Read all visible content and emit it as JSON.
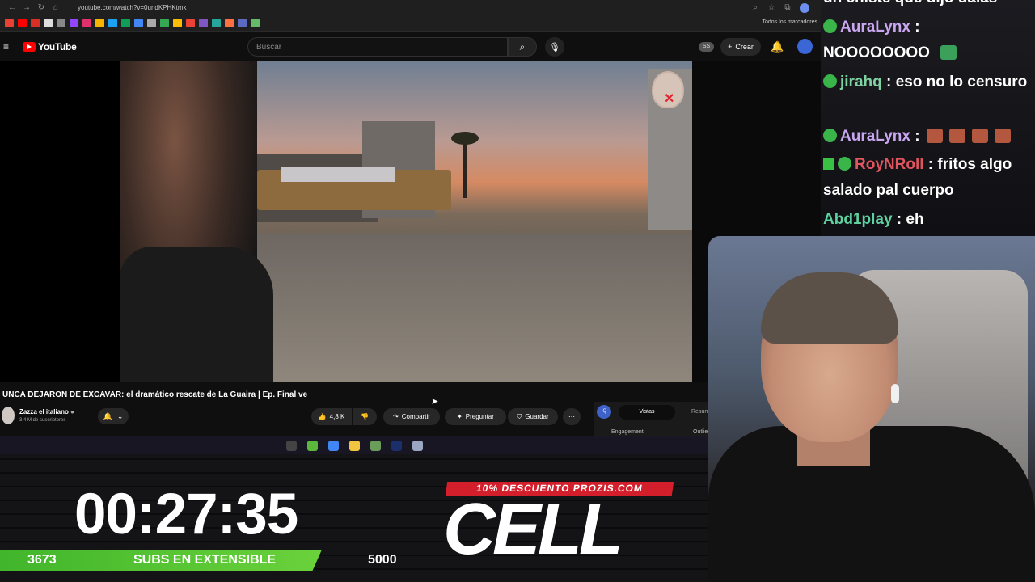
{
  "browser": {
    "url": "youtube.com/watch?v=0undKPHKtmk",
    "bookmarks_folder": "Todos los marcadores"
  },
  "youtube": {
    "logo_text": "YouTube",
    "search_placeholder": "Buscar",
    "badge": "SS",
    "create_label": "Crear"
  },
  "video": {
    "title": "UNCA DEJARON DE EXCAVAR: el dramático rescate de La Guaira | Ep. Final ve",
    "channel": "Zazza el italiano",
    "subscribers": "3,4 M de suscriptores",
    "likes": "4,8 K",
    "share_label": "Compartir",
    "ask_label": "Preguntar",
    "save_label": "Guardar"
  },
  "stats": {
    "badge": "IQ",
    "tab_active": "Vistas",
    "tab_next": "Resum",
    "label_1": "Engagement",
    "label_2": "Outlie"
  },
  "overlay": {
    "timer": "00:27:35",
    "subs_count": "3673",
    "subs_label": "SUBS EN EXTENSIBLE",
    "subs_goal": "5000",
    "promo": "10% DESCUENTO PROZIS.COM",
    "logo": "CELL"
  },
  "chat": {
    "top_fragment": "un chiste que dijo dalas",
    "messages": [
      {
        "user": "AuraLynx",
        "color": "#c9a6f0",
        "text": "NOOOOOOOO"
      },
      {
        "user": "jirahq",
        "color": "#7fd2a2",
        "text": "eso no lo censuro"
      },
      {
        "user": "AuraLynx",
        "color": "#c9a6f0",
        "text": ""
      },
      {
        "user": "RoyNRoll",
        "color": "#e0555e",
        "text": "fritos algo salado pal cuerpo"
      },
      {
        "user": "Abd1play",
        "color": "#5fd0a0",
        "text": "eh"
      }
    ]
  },
  "colors": {
    "yt_red": "#ff0000",
    "subs_green": "#4cc431",
    "promo_red": "#d21f2b"
  }
}
